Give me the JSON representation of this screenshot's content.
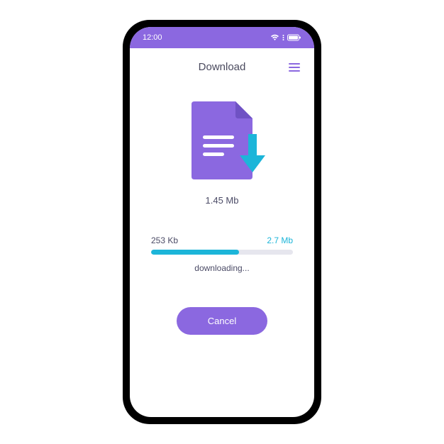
{
  "status_bar": {
    "time": "12:00",
    "wifi_icon": "wifi",
    "signal_icon": "signal",
    "battery_icon": "battery"
  },
  "header": {
    "title": "Download",
    "menu_icon": "hamburger"
  },
  "download": {
    "file_size_label": "1.45 Mb",
    "downloaded_label": "253 Kb",
    "total_label": "2.7 Mb",
    "progress_percent": 62,
    "status_text": "downloading...",
    "cancel_label": "Cancel"
  },
  "colors": {
    "accent_purple": "#8b68e0",
    "accent_cyan": "#1cb5d9",
    "text_dark": "#4b4b66",
    "track_bg": "#e6e6ee"
  }
}
